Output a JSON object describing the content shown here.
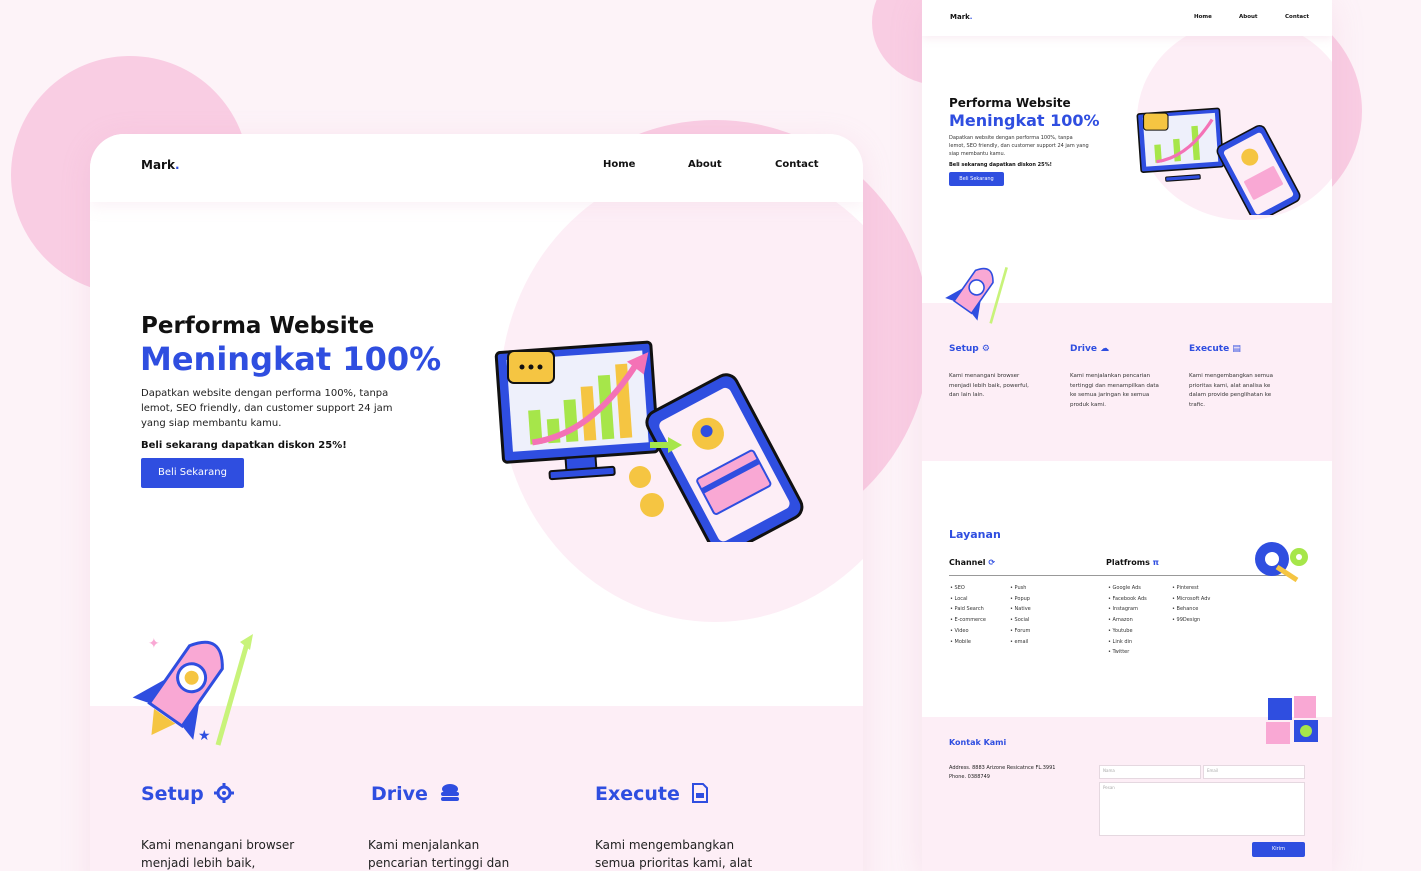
{
  "colors": {
    "accent": "#2f4ee0",
    "background": "#fdf3f8",
    "blob": "#f9cde3",
    "section": "#fdeef6"
  },
  "brand": {
    "name": "Mark",
    "dot": "."
  },
  "nav": {
    "home": "Home",
    "about": "About",
    "contact": "Contact"
  },
  "hero": {
    "title": "Performa Website",
    "highlight": "Meningkat 100%",
    "description": "Dapatkan website dengan performa 100%, tanpa lemot, SEO friendly, dan customer support 24 jam yang siap membantu kamu.",
    "promo": "Beli sekarang dapatkan diskon 25%!",
    "cta": "Beli Sekarang"
  },
  "services": [
    {
      "title": "Setup",
      "icon": "gear-icon",
      "desc": "Kami menangani browser menjadi lebih baik, powerful, dan lain lain.",
      "desc_visible": "Kami menangani browser menjadi lebih baik,"
    },
    {
      "title": "Drive",
      "icon": "cloud-stack-icon",
      "desc": "Kami menjalankan pencarian tertinggi dan menampilkan data ke semua jaringan ke semua produk kami.",
      "desc_visible": "Kami menjalankan pencarian tertinggi dan"
    },
    {
      "title": "Execute",
      "icon": "document-icon",
      "desc": "Kami mengembangkan semua prioritas kami, alat analisa ke dalam provide penglihatan ke trafic.",
      "desc_visible": "Kami mengembangkan semua prioritas kami, alat"
    }
  ],
  "layanan": {
    "title": "Layanan",
    "channel": {
      "title": "Channel",
      "col1": [
        "SEO",
        "Local",
        "Paid Search",
        "E-commerce",
        "Video",
        "Mobile"
      ],
      "col2": [
        "Push",
        "Popup",
        "Native",
        "Social",
        "Forum",
        "email"
      ]
    },
    "platforms": {
      "title": "Platfroms",
      "col1": [
        "Google Ads",
        "Facebook Ads",
        "Instagram",
        "Amazon",
        "Youtube",
        "Link din",
        "Twitter"
      ],
      "col2": [
        "Pinterest",
        "Microsoft Adv",
        "Behance",
        "99Design"
      ]
    }
  },
  "contact": {
    "title": "Kontak Kami",
    "address": "Address. 8883 Arizone Resicatnce FL.3991",
    "phone": "Phone. 0388749",
    "name_placeholder": "Nama",
    "email_placeholder": "Email",
    "message_placeholder": "Pesan",
    "submit": "Kirim"
  }
}
